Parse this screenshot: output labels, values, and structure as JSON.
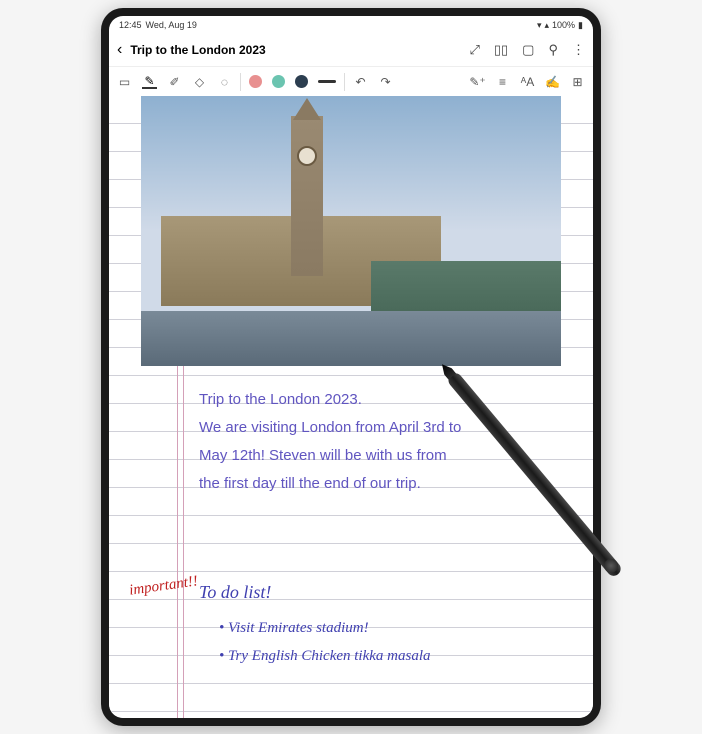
{
  "status": {
    "time": "12:45",
    "date": "Wed, Aug 19",
    "battery": "100%"
  },
  "header": {
    "title": "Trip to the London 2023"
  },
  "note": {
    "line1": "Trip to the London 2023.",
    "line2": "We are visiting London from April 3rd to",
    "line3": "May 12th! Steven will be with us from",
    "line4": "the first day till the end of our trip.",
    "important_label": "important!!",
    "todo_title": "To do list!",
    "todo_items": [
      "Visit Emirates stadium!",
      "Try English Chicken tikka masala"
    ]
  },
  "colors": {
    "pen1": "#e89090",
    "pen2": "#6bc4b0",
    "pen3": "#2c3e50"
  }
}
